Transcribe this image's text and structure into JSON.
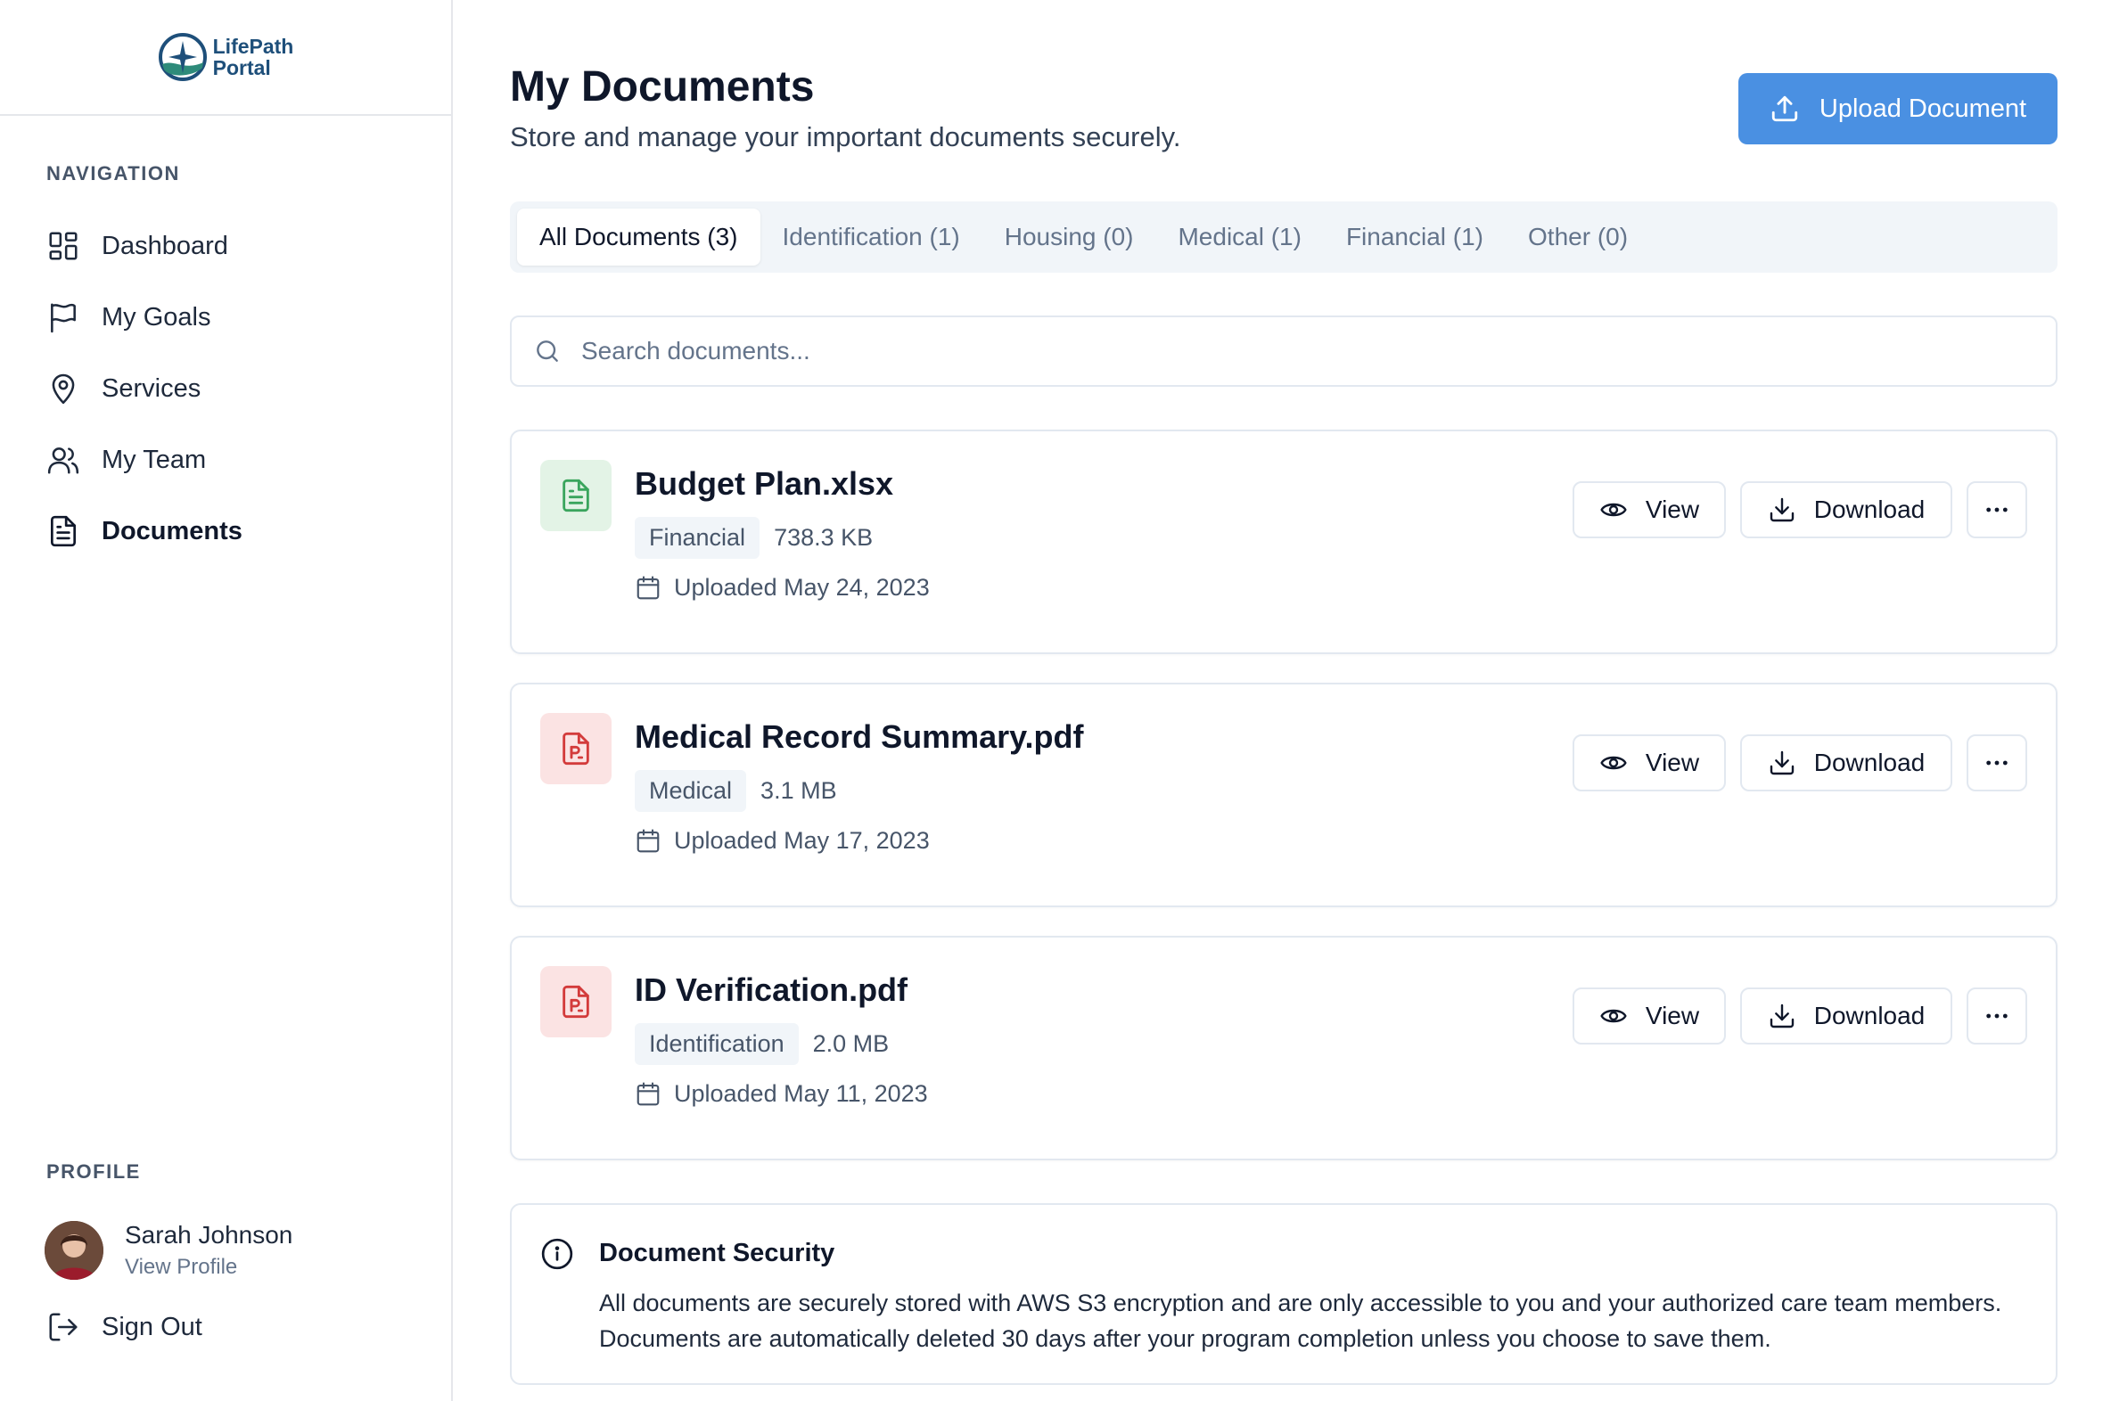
{
  "brand": {
    "line1": "LifePath",
    "line2": "Portal"
  },
  "sidebar": {
    "navigation_label": "NAVIGATION",
    "items": [
      {
        "label": "Dashboard",
        "icon": "dashboard-icon"
      },
      {
        "label": "My Goals",
        "icon": "flag-icon"
      },
      {
        "label": "Services",
        "icon": "map-pin-icon"
      },
      {
        "label": "My Team",
        "icon": "users-icon"
      },
      {
        "label": "Documents",
        "icon": "document-icon",
        "active": true
      }
    ],
    "profile_label": "PROFILE",
    "profile": {
      "name": "Sarah Johnson",
      "link": "View Profile"
    },
    "signout": "Sign Out"
  },
  "header": {
    "title": "My Documents",
    "subtitle": "Store and manage your important documents securely.",
    "upload_label": "Upload Document"
  },
  "tabs": [
    {
      "label": "All Documents (3)",
      "active": true
    },
    {
      "label": "Identification (1)"
    },
    {
      "label": "Housing (0)"
    },
    {
      "label": "Medical (1)"
    },
    {
      "label": "Financial (1)"
    },
    {
      "label": "Other (0)"
    }
  ],
  "search": {
    "placeholder": "Search documents...",
    "value": ""
  },
  "actions": {
    "view": "View",
    "download": "Download"
  },
  "documents": [
    {
      "name": "Budget Plan.xlsx",
      "category": "Financial",
      "size": "738.3 KB",
      "uploaded": "Uploaded May 24, 2023",
      "icon_color": "#3aa55d"
    },
    {
      "name": "Medical Record Summary.pdf",
      "category": "Medical",
      "size": "3.1 MB",
      "uploaded": "Uploaded May 17, 2023",
      "icon_color": "#d33b3b"
    },
    {
      "name": "ID Verification.pdf",
      "category": "Identification",
      "size": "2.0 MB",
      "uploaded": "Uploaded May 11, 2023",
      "icon_color": "#d33b3b"
    }
  ],
  "security": {
    "title": "Document Security",
    "body": "All documents are securely stored with AWS S3 encryption and are only accessible to you and your authorized care team members. Documents are automatically deleted 30 days after your program completion unless you choose to save them."
  },
  "colors": {
    "accent": "#4a90e2",
    "text": "#0f172a",
    "muted": "#64748b",
    "border": "#e2e8f0"
  }
}
